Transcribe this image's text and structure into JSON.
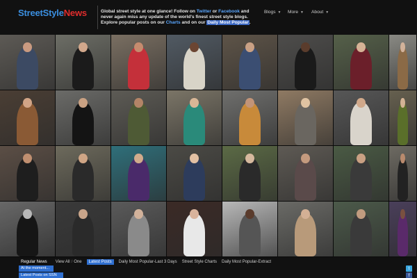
{
  "header": {
    "logo_part1": "StreetStyle",
    "logo_part2": "News",
    "tagline_1": "Global street style at one glance! Follow on ",
    "tagline_twitter": "Twitter",
    "tagline_or": " or ",
    "tagline_facebook": "Facebook",
    "tagline_2": " and ",
    "tagline_3": "never again miss any update of the world's finest street style blogs.",
    "tagline_4": "Explore popular posts on our ",
    "tagline_charts": "Charts",
    "tagline_5": " and on our ",
    "tagline_dmp": "Daily Most Popular",
    "tagline_6": "."
  },
  "nav": {
    "items": [
      {
        "label": "Blogs",
        "icon": "caret-down-icon"
      },
      {
        "label": "More",
        "icon": "caret-down-icon"
      },
      {
        "label": "About",
        "icon": "caret-down-icon"
      }
    ]
  },
  "grid": {
    "tiles": [
      {
        "bg": "#5d5a55",
        "fig": "#3c4a63",
        "head": "#c99a80"
      },
      {
        "bg": "#6d6e66",
        "fig": "#1b1b1b",
        "head": "#d2a88c"
      },
      {
        "bg": "#7a6f62",
        "fig": "#c4303a",
        "head": "#c58b6e"
      },
      {
        "bg": "#515a63",
        "fig": "#d8d4c8",
        "head": "#6b4532"
      },
      {
        "bg": "#5e5448",
        "fig": "#3b4e72",
        "head": "#c9a084"
      },
      {
        "bg": "#4e4d4b",
        "fig": "#1a1a1a",
        "head": "#5a3c2c"
      },
      {
        "bg": "#556049",
        "fig": "#6b1f2a",
        "head": "#d6b396"
      },
      {
        "bg": "#8a8a84",
        "fig": "#8b6a46",
        "head": "#d2b29a"
      },
      {
        "bg": "#4a3e34",
        "fig": "#8a5a35",
        "head": "#d1a486"
      },
      {
        "bg": "#6b6b68",
        "fig": "#141414",
        "head": "#c9a183"
      },
      {
        "bg": "#5d5b55",
        "fig": "#4e5a35",
        "head": "#b38467"
      },
      {
        "bg": "#7b7567",
        "fig": "#2a8a7a",
        "head": "#d8b696"
      },
      {
        "bg": "#6f6f6d",
        "fig": "#c88a3a",
        "head": "#c29478"
      },
      {
        "bg": "#8f7a63",
        "fig": "#6a6660",
        "head": "#e0c3a2"
      },
      {
        "bg": "#575757",
        "fig": "#d9d4cb",
        "head": "#d0a88a"
      },
      {
        "bg": "#66604f",
        "fig": "#5a6f2a",
        "head": "#d2b294"
      },
      {
        "bg": "#5b4e45",
        "fig": "#1e1e1e",
        "head": "#c08f70"
      },
      {
        "bg": "#6d6a5c",
        "fig": "#2a2a2a",
        "head": "#cfa585"
      },
      {
        "bg": "#2f6f7a",
        "fig": "#4a2a6a",
        "head": "#d1ab8c"
      },
      {
        "bg": "#4b4a45",
        "fig": "#2d3c5c",
        "head": "#e2c0a3"
      },
      {
        "bg": "#5b6a45",
        "fig": "#2a2a2a",
        "head": "#d6b99e"
      },
      {
        "bg": "#5e5a54",
        "fig": "#5a4a4a",
        "head": "#c49a7e"
      },
      {
        "bg": "#4a5a44",
        "fig": "#3a3a3a",
        "head": "#c9a083"
      },
      {
        "bg": "#6d6a62",
        "fig": "#222222",
        "head": "#b98a6d"
      },
      {
        "bg": "#7a7a7a",
        "fig": "#1a1a1a",
        "head": "#d8d8d8",
        "bw": true
      },
      {
        "bg": "#3a3a3a",
        "fig": "#2a2a2a",
        "head": "#c9a58a"
      },
      {
        "bg": "#5a5a5a",
        "fig": "#8a8a8a",
        "head": "#d2b29b"
      },
      {
        "bg": "#3b2a26",
        "fig": "#e8e8e8",
        "head": "#d8b39c"
      },
      {
        "bg": "#b8b8b8",
        "fig": "#555555",
        "head": "#5a3b2c"
      },
      {
        "bg": "#6a6a66",
        "fig": "#b89a7a",
        "head": "#d3b095"
      },
      {
        "bg": "#4c5a4a",
        "fig": "#3a3a3a",
        "head": "#c09b7f"
      },
      {
        "bg": "#4a3f5a",
        "fig": "#5a2a6a",
        "head": "#7a5040"
      }
    ]
  },
  "subnav": {
    "label": "Regular News",
    "view_all": "View All",
    "sep": "/",
    "one": "One",
    "latest": "Latest Posts",
    "dmp_3": "Daily Most Popular-Last 3 Days",
    "charts": "Street Style Charts",
    "dmp_extract": "Daily Most Popular-Extract"
  },
  "buttons": {
    "at_moment": "At the moment...",
    "latest_ssn": "Latest Posts on SSN"
  },
  "social": {
    "twitter_icon": "twitter-icon",
    "twitter_color": "#3aa7e0",
    "facebook_icon": "facebook-icon",
    "facebook_color": "#3b5998"
  },
  "colors": {
    "logo_blue": "#3b8fe0",
    "logo_red": "#e02d2d",
    "accent": "#2f6fd0"
  }
}
